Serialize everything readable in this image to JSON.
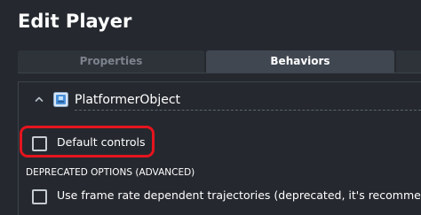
{
  "header": {
    "title": "Edit Player"
  },
  "tabs": [
    {
      "label": "Properties",
      "selected": false
    },
    {
      "label": "Behaviors",
      "selected": true
    }
  ],
  "behavior": {
    "name": "PlatformerObject",
    "expanded": true,
    "icon": "platformer-behavior-icon"
  },
  "options": {
    "default_controls": {
      "label": "Default controls",
      "checked": false
    },
    "deprecated_section_label": "DEPRECATED OPTIONS (ADVANCED)",
    "frame_rate_dependent": {
      "label": "Use frame rate dependent trajectories (deprecated, it's recommende",
      "checked": false
    }
  },
  "colors": {
    "background": "#25292f",
    "tab_selected": "#404751",
    "tab_unselected": "#2e333a",
    "highlight": "#e5141e",
    "icon_blue": "#4a90d9"
  }
}
